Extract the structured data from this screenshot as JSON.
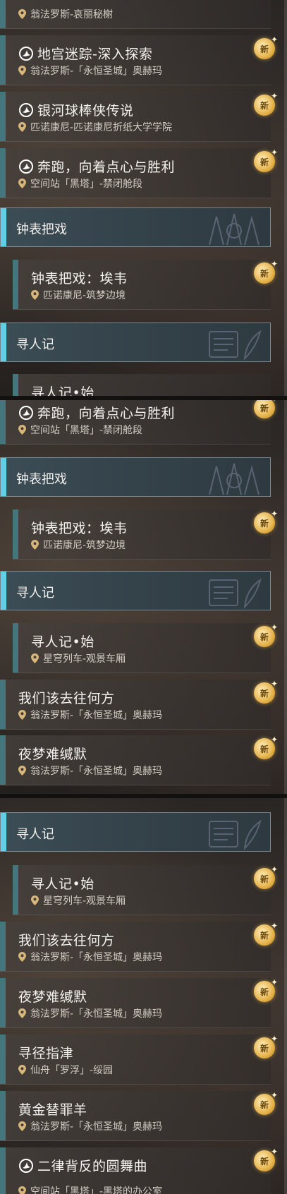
{
  "badge_text": "新",
  "colors": {
    "accent_bar": "#45757d",
    "header_bar": "#62d0e4",
    "badge_gold": "#e6b24a"
  },
  "icons": {
    "mission": "mission-type-icon",
    "location": "location-pin-icon",
    "badge": "new-badge-icon"
  },
  "panel1": {
    "items": [
      {
        "title": "",
        "loc": "翁法罗斯-哀丽秘榭"
      },
      {
        "title": "地宫迷踪-深入探索",
        "loc": "翁法罗斯-「永恒圣城」奥赫玛"
      },
      {
        "title": "银河球棒侠传说",
        "loc": "匹诺康尼-匹诺康尼折纸大学学院"
      },
      {
        "title": "奔跑，向着点心与胜利",
        "loc": "空间站「黑塔」-禁闭舱段"
      },
      {
        "header": "钟表把戏"
      },
      {
        "title": "钟表把戏：埃韦",
        "loc": "匹诺康尼-筑梦边境"
      },
      {
        "header": "寻人记"
      },
      {
        "title": "寻人记•始"
      }
    ]
  },
  "panel2": {
    "items": [
      {
        "title": "奔跑，向着点心与胜利",
        "loc": "空间站「黑塔」-禁闭舱段"
      },
      {
        "header": "钟表把戏"
      },
      {
        "title": "钟表把戏：埃韦",
        "loc": "匹诺康尼-筑梦边境"
      },
      {
        "header": "寻人记"
      },
      {
        "title": "寻人记•始",
        "loc": "星穹列车-观景车厢"
      },
      {
        "title": "我们该去往何方",
        "loc": "翁法罗斯-「永恒圣城」奥赫玛"
      },
      {
        "title": "夜梦难缄默",
        "loc": "翁法罗斯-「永恒圣城」奥赫玛"
      }
    ]
  },
  "panel3": {
    "items": [
      {
        "header": "寻人记"
      },
      {
        "title": "寻人记•始",
        "loc": "星穹列车-观景车厢"
      },
      {
        "title": "我们该去往何方",
        "loc": "翁法罗斯-「永恒圣城」奥赫玛"
      },
      {
        "title": "夜梦难缄默",
        "loc": "翁法罗斯-「永恒圣城」奥赫玛"
      },
      {
        "title": "寻径指津",
        "loc": "仙舟「罗浮」-绥园"
      },
      {
        "title": "黄金替罪羊",
        "loc": "翁法罗斯-「永恒圣城」奥赫玛"
      },
      {
        "title": "二律背反的圆舞曲",
        "loc": "空间站「黑塔」-黑塔的办公室"
      }
    ]
  }
}
